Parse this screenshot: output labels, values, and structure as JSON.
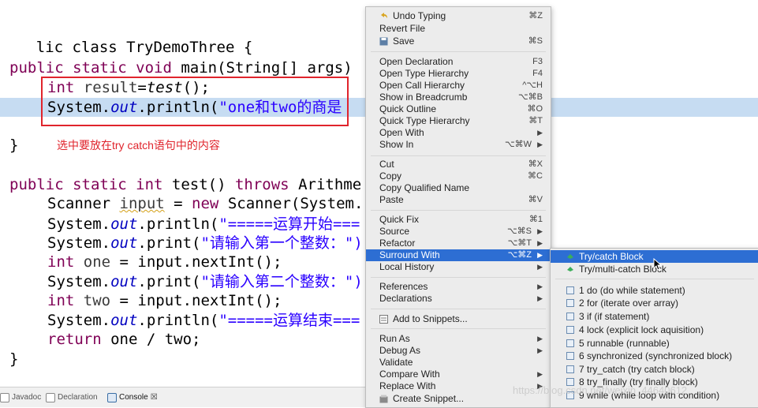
{
  "editor": {
    "class_decl": "lic class TryDemoThree {",
    "main_decl": {
      "kw1": "public static void",
      "rest": " main(String[] args)"
    },
    "line_result": {
      "kw": "int",
      "var": " result",
      "eq": "=",
      "call": "test",
      "tail": "();"
    },
    "line_println": {
      "pre": "System.",
      "out": "out",
      "mid": ".println(",
      "str": "\"one和two的商是"
    },
    "close1": "}",
    "annotation": "选中要放在try catch语句中的内容",
    "test_decl": {
      "kw1": "public static int",
      "name": " test()",
      "kw2": " throws",
      "rest": " Arithme"
    },
    "scanner_line": {
      "pre": "Scanner ",
      "var": "input",
      "mid": " = ",
      "kw": "new",
      "rest": " Scanner(System."
    },
    "p1": {
      "pre": "System.",
      "out": "out",
      "mid": ".println(",
      "str": "\"=====运算开始==="
    },
    "p2": {
      "pre": "System.",
      "out": "out",
      "mid": ".print(",
      "str": "\"请输入第一个整数：\")"
    },
    "one_line": {
      "kw": "int",
      "var": " one",
      "rest": " = input.nextInt();"
    },
    "p3": {
      "pre": "System.",
      "out": "out",
      "mid": ".print(",
      "str": "\"请输入第二个整数：\")"
    },
    "two_line": {
      "kw": "int",
      "var": " two",
      "rest": " = input.nextInt();"
    },
    "p4": {
      "pre": "System.",
      "out": "out",
      "mid": ".println(",
      "str": "\"=====运算结束==="
    },
    "return_line": {
      "kw": "return",
      "rest": " one / two;"
    },
    "close2": "}"
  },
  "bottom_tabs": [
    {
      "label": "Javadoc",
      "active": false
    },
    {
      "label": "Declaration",
      "active": false
    },
    {
      "label": "Console",
      "active": true,
      "close": "☒"
    }
  ],
  "context_menu": {
    "items": [
      {
        "label": "Undo Typing",
        "shortcut": "⌘Z",
        "icon": "undo-icon"
      },
      {
        "label": "Revert File",
        "shortcut": ""
      },
      {
        "label": "Save",
        "shortcut": "⌘S",
        "icon": "save-icon"
      },
      {
        "label": "Open Declaration",
        "shortcut": "F3"
      },
      {
        "label": "Open Type Hierarchy",
        "shortcut": "F4"
      },
      {
        "label": "Open Call Hierarchy",
        "shortcut": "^⌥H"
      },
      {
        "label": "Show in Breadcrumb",
        "shortcut": "⌥⌘B"
      },
      {
        "label": "Quick Outline",
        "shortcut": "⌘O"
      },
      {
        "label": "Quick Type Hierarchy",
        "shortcut": "⌘T"
      },
      {
        "label": "Open With",
        "submenu": true
      },
      {
        "label": "Show In",
        "shortcut": "⌥⌘W",
        "submenu": true
      },
      {
        "label": "Cut",
        "shortcut": "⌘X"
      },
      {
        "label": "Copy",
        "shortcut": "⌘C"
      },
      {
        "label": "Copy Qualified Name",
        "shortcut": ""
      },
      {
        "label": "Paste",
        "shortcut": "⌘V"
      },
      {
        "label": "Quick Fix",
        "shortcut": "⌘1"
      },
      {
        "label": "Source",
        "shortcut": "⌥⌘S",
        "submenu": true
      },
      {
        "label": "Refactor",
        "shortcut": "⌥⌘T",
        "submenu": true
      },
      {
        "label": "Surround With",
        "shortcut": "⌥⌘Z",
        "submenu": true,
        "selected": true
      },
      {
        "label": "Local History",
        "submenu": true
      },
      {
        "label": "References",
        "submenu": true
      },
      {
        "label": "Declarations",
        "submenu": true
      },
      {
        "label": "Add to Snippets...",
        "icon": "snippet-icon"
      },
      {
        "label": "Run As",
        "submenu": true
      },
      {
        "label": "Debug As",
        "submenu": true
      },
      {
        "label": "Validate"
      },
      {
        "label": "Compare With",
        "submenu": true
      },
      {
        "label": "Replace With",
        "submenu": true
      },
      {
        "label": "Create Snippet...",
        "icon": "snippet-icon"
      }
    ]
  },
  "surround_submenu": {
    "items": [
      {
        "label": "Try/catch Block",
        "selected": true,
        "icon": "try-catch-icon"
      },
      {
        "label": "Try/multi-catch Block",
        "icon": "try-multicatch-icon"
      },
      {
        "label": "1 do (do while statement)",
        "icon": "template-icon"
      },
      {
        "label": "2 for (iterate over array)",
        "icon": "template-icon"
      },
      {
        "label": "3 if (if statement)",
        "icon": "template-icon"
      },
      {
        "label": "4 lock (explicit lock aquisition)",
        "icon": "template-icon"
      },
      {
        "label": "5 runnable (runnable)",
        "icon": "template-icon"
      },
      {
        "label": "6 synchronized (synchronized block)",
        "icon": "template-icon"
      },
      {
        "label": "7 try_catch (try catch block)",
        "icon": "template-icon"
      },
      {
        "label": "8 try_finally (try finally block)",
        "icon": "template-icon"
      },
      {
        "label": "9 while (while loop with condition)",
        "icon": "template-icon"
      }
    ]
  },
  "watermark": "https://blog.csdn.net/weixin_44640612"
}
